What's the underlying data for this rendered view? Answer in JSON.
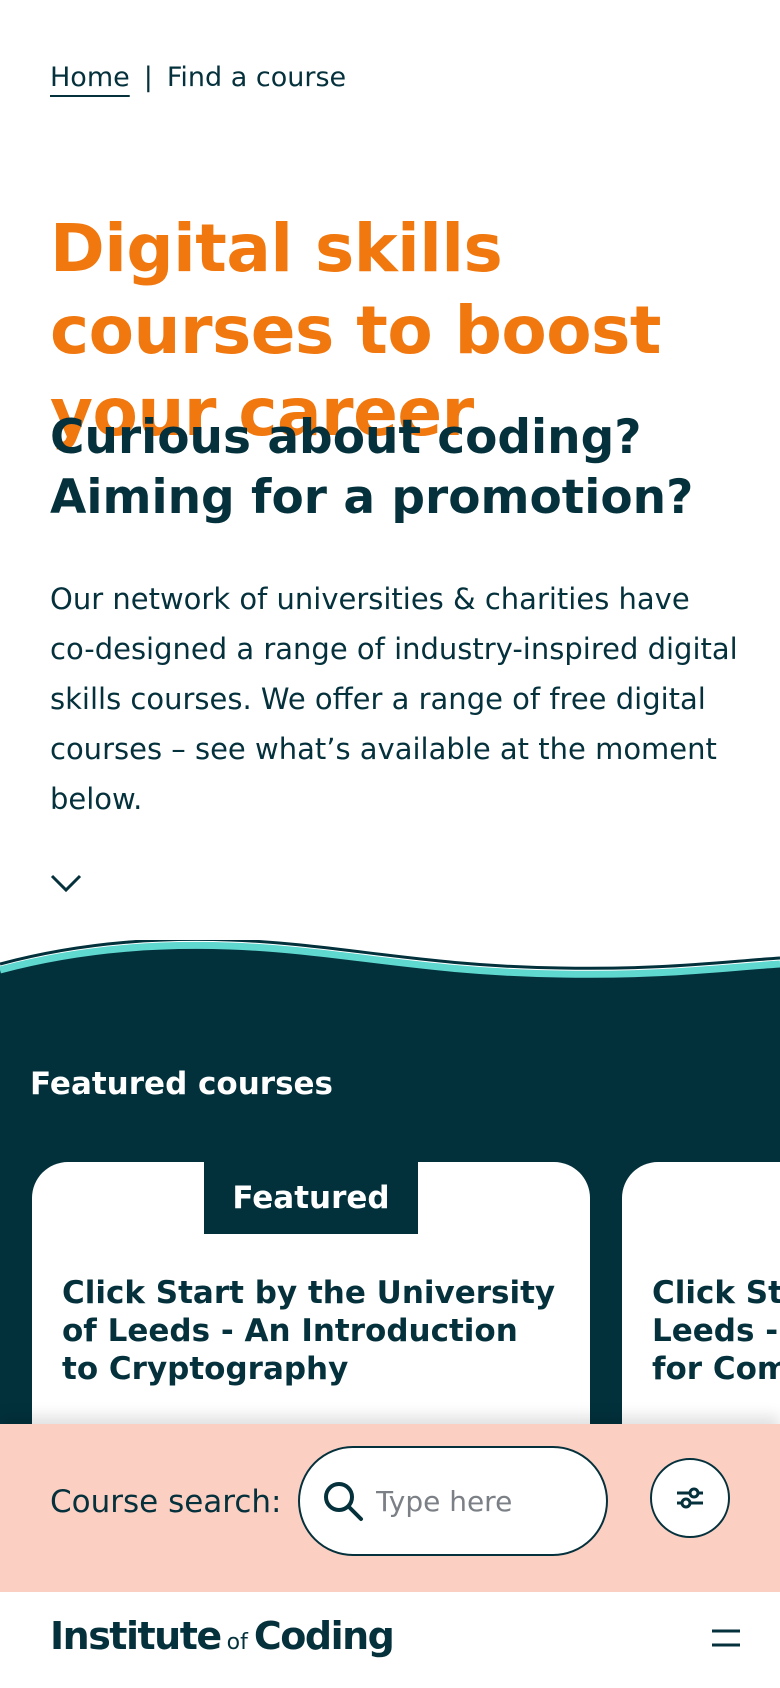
{
  "breadcrumb": {
    "home": "Home",
    "separator": "|",
    "current": "Find a course"
  },
  "hero": {
    "title": "Digital skills courses to boost your career",
    "subtitle_line1": "Curious about coding?",
    "subtitle_line2": "Aiming for a promotion?",
    "body": "Our network of universities & charities have co-designed a range of industry-inspired digital skills courses. We offer a range of free digital courses – see what’s available at the moment below."
  },
  "featured": {
    "heading": "Featured courses",
    "cards": [
      {
        "badge": "Featured",
        "title": "Click Start by the University of Leeds - An Introduction to Cryptography"
      },
      {
        "title_line1": "Click Start by the University of",
        "title_line2": "Leeds - An Introduction to Python",
        "title_line3": "for Computing"
      }
    ]
  },
  "search": {
    "label": "Course search:",
    "placeholder": "Type here",
    "value": ""
  },
  "footer": {
    "logo_part1": "Institute",
    "logo_of": "of",
    "logo_part2": "Coding"
  },
  "colors": {
    "accent_orange": "#f0780f",
    "navy": "#02313c",
    "teal_wave": "#5fd8cf",
    "search_bg": "#fccfc3"
  },
  "icons": {
    "chevron": "chevron-down-icon",
    "search": "search-icon",
    "filter": "filter-sliders-icon",
    "menu": "menu-icon"
  }
}
